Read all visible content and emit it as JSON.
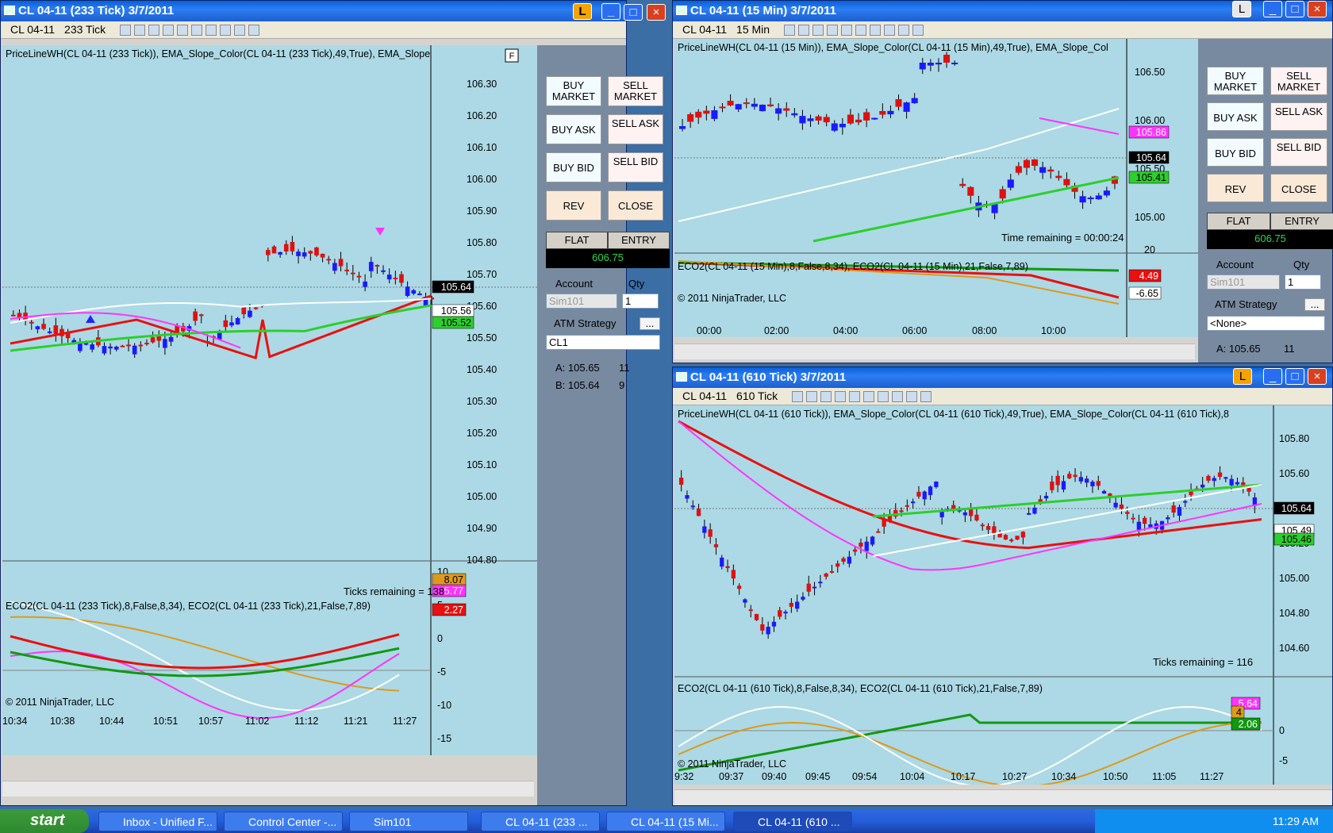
{
  "win1": {
    "title": "CL 04-11 (233 Tick)  3/7/2011",
    "instrument": "CL 04-11",
    "period": "233 Tick",
    "header": "PriceLineWH(CL 04-11  (233 Tick)),  EMA_Slope_Color(CL 04-11  (233 Tick),49,True),  EMA_Slope",
    "price_ticks": [
      "106.30",
      "106.20",
      "106.10",
      "106.00",
      "105.90",
      "105.80",
      "105.70",
      "105.60",
      "105.50",
      "105.40",
      "105.30",
      "105.20",
      "105.10",
      "105.00",
      "104.90",
      "104.80"
    ],
    "last": "105.64",
    "ema_white": "105.56",
    "ema_green": "105.52",
    "remaining": "Ticks remaining = 138",
    "osc_header": "ECO2(CL 04-11  (233 Tick),8,False,8,34),  ECO2(CL 04-11  (233 Tick),21,False,7,89)",
    "osc_ticks": [
      "10",
      "5",
      "0",
      "-5",
      "-10",
      "-15"
    ],
    "osc_tags": [
      "8.07",
      "5.77",
      "2.27"
    ],
    "copyright": "© 2011 NinjaTrader, LLC",
    "time_ticks": [
      "10:34",
      "10:38",
      "10:44",
      "10:51",
      "10:57",
      "11:02",
      "11:12",
      "11:21",
      "11:27"
    ]
  },
  "panel1": {
    "buy_market": "BUY MARKET",
    "sell_market": "SELL MARKET",
    "buy_ask": "BUY ASK",
    "sell_ask": "SELL ASK",
    "buy_bid": "BUY BID",
    "sell_bid": "SELL BID",
    "rev": "REV",
    "close": "CLOSE",
    "flat": "FLAT",
    "entry": "ENTRY",
    "pnl": "606.75",
    "account_label": "Account",
    "qty_label": "Qty",
    "account": "Sim101",
    "qty": "1",
    "atm_label": "ATM Strategy",
    "atm_btn": "...",
    "atm": "CL1",
    "ask": "A:  105.65",
    "ask_size": "11",
    "bid": "B:  105.64",
    "bid_size": "9"
  },
  "win2": {
    "title": "CL 04-11 (15 Min)  3/7/2011",
    "instrument": "CL 04-11",
    "period": "15 Min",
    "header": "PriceLineWH(CL 04-11  (15  Min)),  EMA_Slope_Color(CL 04-11  (15 Min),49,True),  EMA_Slope_Col",
    "price_ticks": [
      "106.50",
      "106.00",
      "105.50",
      "105.00"
    ],
    "last": "105.64",
    "ema_magenta": "105.86",
    "ema_green": "105.41",
    "remaining": "Time remaining = 00:00:24",
    "osc_header": "ECO2(CL 04-11  (15 Min),8,False,8,34),  ECO2(CL 04-11  (15 Min),21,False,7,89)",
    "osc_ticks": [
      "20"
    ],
    "osc_tags": [
      "4.49",
      "-6.65"
    ],
    "copyright": "© 2011 NinjaTrader, LLC",
    "time_ticks": [
      "00:00",
      "02:00",
      "04:00",
      "06:00",
      "08:00",
      "10:00"
    ]
  },
  "panel2": {
    "buy_market": "BUY MARKET",
    "sell_market": "SELL MARKET",
    "buy_ask": "BUY ASK",
    "sell_ask": "SELL ASK",
    "buy_bid": "BUY BID",
    "sell_bid": "SELL BID",
    "rev": "REV",
    "close": "CLOSE",
    "flat": "FLAT",
    "entry": "ENTRY",
    "pnl": "606.75",
    "account_label": "Account",
    "qty_label": "Qty",
    "account": "Sim101",
    "qty": "1",
    "atm_label": "ATM Strategy",
    "atm_btn": "...",
    "atm": "<None>",
    "ask": "A:  105.65",
    "ask_size": "11"
  },
  "win3": {
    "title": "CL 04-11 (610 Tick)  3/7/2011",
    "instrument": "CL 04-11",
    "period": "610 Tick",
    "header": "PriceLineWH(CL 04-11  (610 Tick)),  EMA_Slope_Color(CL 04-11  (610 Tick),49,True),  EMA_Slope_Color(CL 04-11  (610 Tick),8",
    "price_ticks": [
      "105.80",
      "105.60",
      "105.40",
      "105.20",
      "105.00",
      "104.80",
      "104.60"
    ],
    "last": "105.64",
    "ema_white": "105.49",
    "ema_green": "105.46",
    "remaining": "Ticks remaining = 116",
    "osc_header": "ECO2(CL 04-11  (610 Tick),8,False,8,34),  ECO2(CL 04-11  (610 Tick),21,False,7,89)",
    "osc_ticks": [
      "0",
      "-5"
    ],
    "osc_tags": [
      "5.64",
      "4",
      "2.06"
    ],
    "copyright": "© 2011 NinjaTrader, LLC",
    "time_ticks": [
      "9:32",
      "09:37",
      "09:40",
      "09:45",
      "09:54",
      "10:04",
      "10:17",
      "10:27",
      "10:34",
      "10:50",
      "11:05",
      "11:27"
    ]
  },
  "common": {
    "f_label": "F",
    "minimize": "_",
    "maximize": "□",
    "close": "×",
    "lock": "L"
  },
  "taskbar": {
    "start": "start",
    "items": [
      "Inbox - Unified F...",
      "Control Center -...",
      "Sim101",
      "CL 04-11 (233 ...",
      "CL 04-11 (15 Mi...",
      "CL 04-11 (610 ..."
    ],
    "clock": "11:29 AM"
  }
}
